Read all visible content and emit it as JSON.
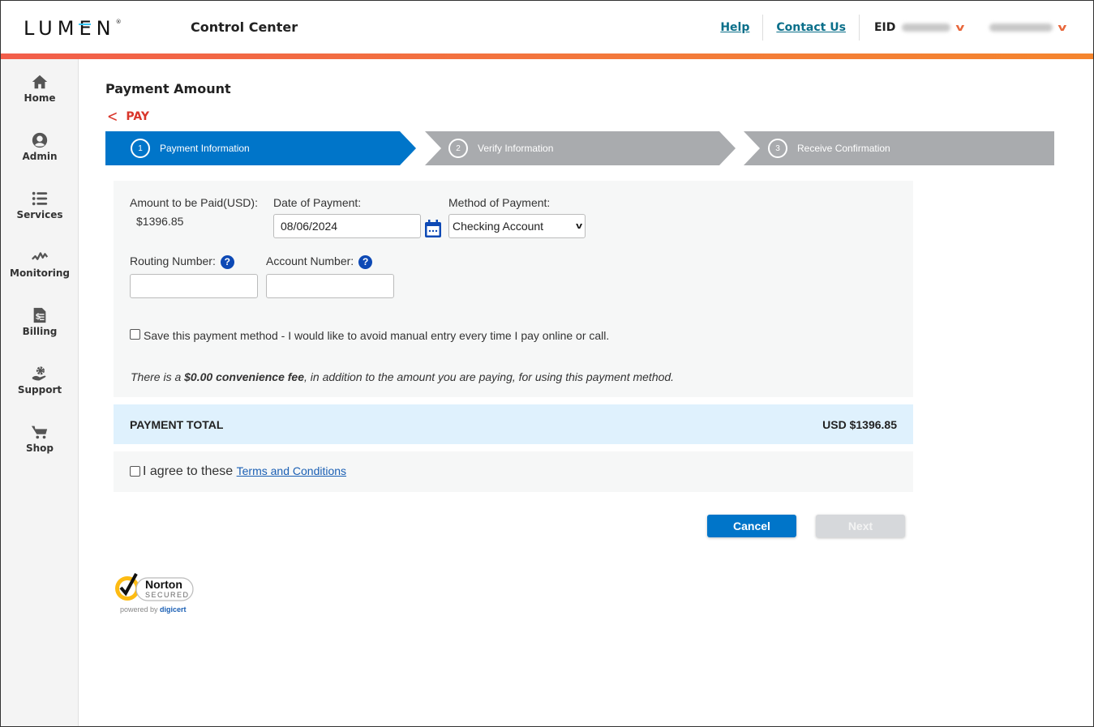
{
  "header": {
    "brand": "LUMEN",
    "app_title": "Control Center",
    "links": [
      "Help",
      "Contact Us"
    ],
    "eid_label": "EID",
    "accent_colors": [
      "#f25d4a",
      "#f5852e"
    ]
  },
  "sidebar": {
    "items": [
      {
        "label": "Home",
        "icon": "home-icon"
      },
      {
        "label": "Admin",
        "icon": "user-circle-icon"
      },
      {
        "label": "Services",
        "icon": "list-icon"
      },
      {
        "label": "Monitoring",
        "icon": "pulse-icon"
      },
      {
        "label": "Billing",
        "icon": "bill-icon"
      },
      {
        "label": "Support",
        "icon": "support-icon"
      },
      {
        "label": "Shop",
        "icon": "cart-icon"
      }
    ]
  },
  "page": {
    "title": "Payment Amount",
    "back_label": "PAY"
  },
  "stepper": {
    "steps": [
      {
        "num": "1",
        "label": "Payment Information",
        "active": true
      },
      {
        "num": "2",
        "label": "Verify Information",
        "active": false
      },
      {
        "num": "3",
        "label": "Receive Confirmation",
        "active": false
      }
    ],
    "active_color": "#0075c9",
    "inactive_color": "#a9abae"
  },
  "form": {
    "amount_label": "Amount to be Paid(USD):",
    "amount_value": "$1396.85",
    "date_label": "Date of Payment:",
    "date_value": "08/06/2024",
    "method_label": "Method of Payment:",
    "method_value": "Checking Account",
    "routing_label": "Routing Number:",
    "routing_value": "",
    "account_label": "Account Number:",
    "account_value": "",
    "help_glyph": "?",
    "save_method_label": "Save this payment method - I would like to avoid manual entry every time I pay online or call.",
    "save_method_checked": false,
    "fee_note_pre": "There is a ",
    "fee_note_bold": "$0.00 convenience fee",
    "fee_note_post": ", in addition to the amount you are paying, for using this payment method."
  },
  "total": {
    "label": "PAYMENT TOTAL",
    "value": "USD $1396.85"
  },
  "agree": {
    "text": "I agree to these ",
    "link": "Terms and Conditions",
    "checked": false
  },
  "buttons": {
    "cancel": "Cancel",
    "next": "Next"
  },
  "badge": {
    "name": "Norton",
    "sub": "SECURED",
    "powered": "powered by ",
    "powered_brand": "digicert"
  }
}
